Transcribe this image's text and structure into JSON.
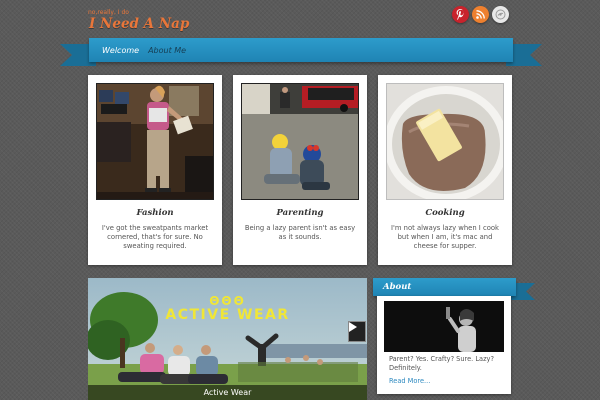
{
  "site": {
    "tagline": "no,really, I do",
    "title": "I Need A Nap"
  },
  "social": [
    {
      "name": "pinterest",
      "icon": "pinterest-icon",
      "color": "#c8232c"
    },
    {
      "name": "rss",
      "icon": "rss-icon",
      "color": "#ee802f"
    },
    {
      "name": "other",
      "icon": "social-icon",
      "color": "#e8e8e8"
    }
  ],
  "nav": {
    "items": [
      "Welcome",
      "About Me"
    ]
  },
  "cards": [
    {
      "title": "Fashion",
      "desc": "I've got the sweatpants market cornered, that's for sure.  No sweating required."
    },
    {
      "title": "Parenting",
      "desc": "Being a lazy parent isn't as easy as it sounds."
    },
    {
      "title": "Cooking",
      "desc": "I'm not always lazy when I cook but when I am, it's mac and cheese for supper."
    }
  ],
  "slider": {
    "headline_glyphs": "ΘΘΘ",
    "headline": "ACTIVE WEAR",
    "caption": "Active Wear"
  },
  "about": {
    "title": "About",
    "text": "Parent? Yes. Crafty? Sure. Lazy? Definitely.",
    "more": "Read More..."
  },
  "colors": {
    "accent": "#2d9ccb",
    "brand": "#e9763a",
    "link": "#2e8ac0"
  }
}
